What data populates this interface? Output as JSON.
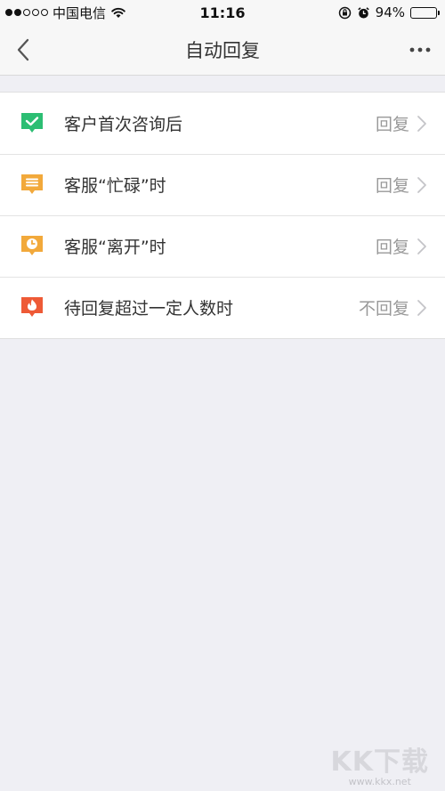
{
  "status_bar": {
    "carrier": "中国电信",
    "time": "11:16",
    "battery": "94%",
    "battery_level": 0.94,
    "signal_bars_filled": 2,
    "signal_bars_total": 5
  },
  "nav": {
    "title": "自动回复",
    "back_icon": "chevron-left-icon",
    "more_icon": "ellipsis-icon"
  },
  "settings": [
    {
      "label": "客户首次咨询后",
      "value": "回复",
      "icon": "check-bubble-icon",
      "icon_color": "#2cbe73"
    },
    {
      "label": "客服“忙碌”时",
      "value": "回复",
      "icon": "message-bubble-icon",
      "icon_color": "#f2a93b"
    },
    {
      "label": "客服“离开”时",
      "value": "回复",
      "icon": "clock-bubble-icon",
      "icon_color": "#f2a93b"
    },
    {
      "label": "待回复超过一定人数时",
      "value": "不回复",
      "icon": "fire-bubble-icon",
      "icon_color": "#ee5a36"
    }
  ],
  "watermark": {
    "logo": "KK下载",
    "url": "www.kkx.net"
  },
  "colors": {
    "background": "#efeff4",
    "text_primary": "#333333",
    "text_secondary": "#999999"
  }
}
